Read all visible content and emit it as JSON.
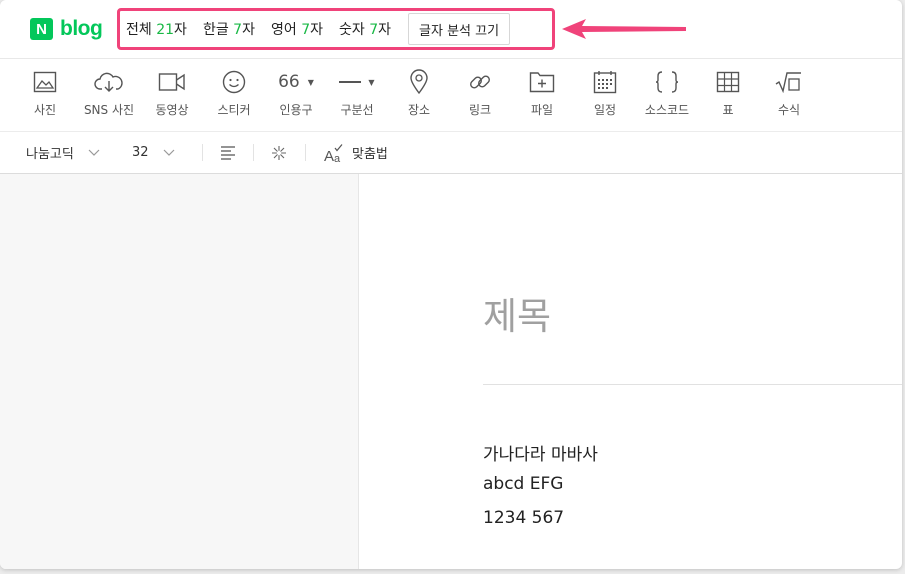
{
  "brand": {
    "mark": "N",
    "name": "blog",
    "color": "#03c75a"
  },
  "counter": {
    "accent": "#19b845",
    "highlight_color": "#f0437a",
    "stats": [
      {
        "label": "전체",
        "value": "21",
        "unit": "자"
      },
      {
        "label": "한글",
        "value": "7",
        "unit": "자"
      },
      {
        "label": "영어",
        "value": "7",
        "unit": "자"
      },
      {
        "label": "숫자",
        "value": "7",
        "unit": "자"
      }
    ],
    "toggle_label": "글자 분석 끄기"
  },
  "toolbar": {
    "items": [
      {
        "label": "사진",
        "icon": "image-icon"
      },
      {
        "label": "SNS 사진",
        "icon": "cloud-download-icon"
      },
      {
        "label": "동영상",
        "icon": "video-icon"
      },
      {
        "label": "스티커",
        "icon": "smiley-icon"
      },
      {
        "label": "인용구",
        "icon": "quote-icon",
        "glyph": "66"
      },
      {
        "label": "구분선",
        "icon": "divider-line-icon"
      },
      {
        "label": "장소",
        "icon": "location-pin-icon"
      },
      {
        "label": "링크",
        "icon": "link-icon"
      },
      {
        "label": "파일",
        "icon": "file-add-icon"
      },
      {
        "label": "일정",
        "icon": "calendar-icon"
      },
      {
        "label": "소스코드",
        "icon": "code-braces-icon"
      },
      {
        "label": "표",
        "icon": "table-icon"
      },
      {
        "label": "수식",
        "icon": "formula-icon"
      }
    ]
  },
  "format": {
    "font": "나눔고딕",
    "size": "32",
    "spellcheck_label": "맞춤법"
  },
  "editor": {
    "title_placeholder": "제목",
    "lines": [
      "가나다라 마바사",
      "abcd EFG",
      "1234 567"
    ]
  }
}
